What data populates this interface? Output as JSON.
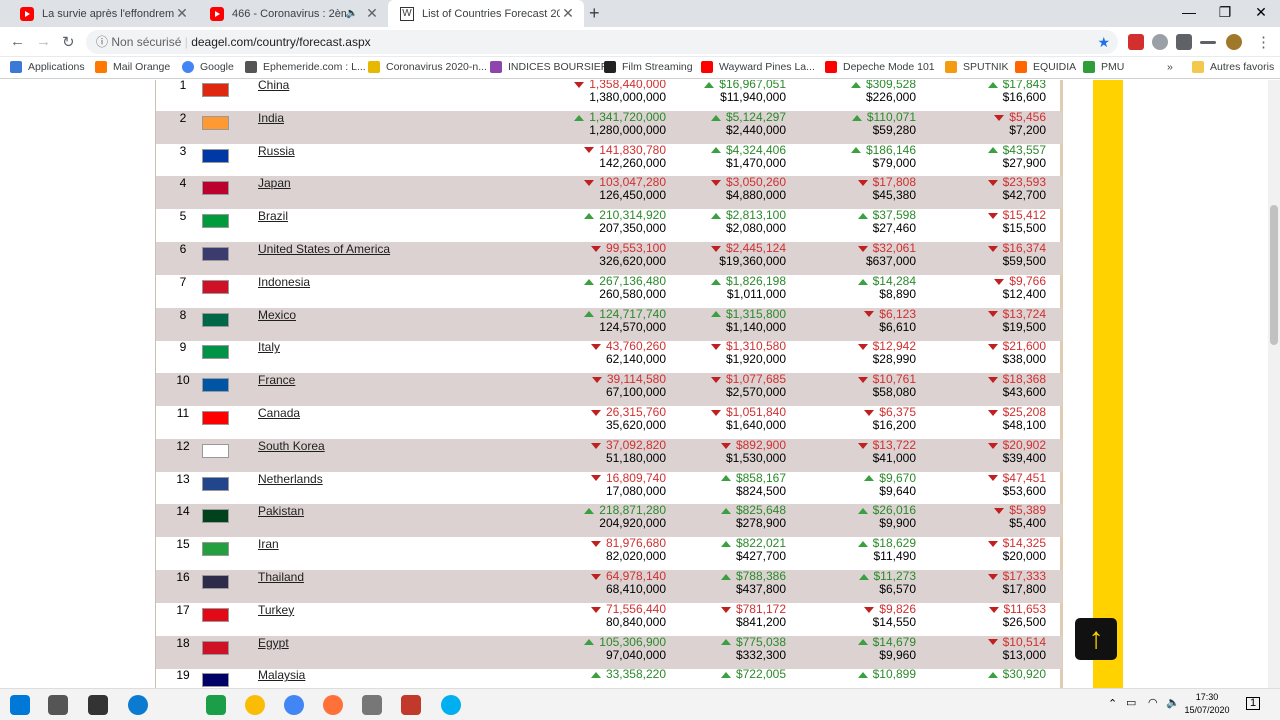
{
  "tabs": [
    {
      "title": "La survie après l'effondrement er",
      "icon": "youtube-icon"
    },
    {
      "title": "466 - Coronavirus : 2ème Sai",
      "icon": "youtube-icon"
    },
    {
      "title": "List of Countries Forecast 2025",
      "icon": "deagel-icon"
    }
  ],
  "address": {
    "security": "Non sécurisé",
    "url": "deagel.com/country/forecast.aspx"
  },
  "bookmarks": [
    {
      "label": "Applications",
      "color": "#3c78d8"
    },
    {
      "label": "Mail Orange",
      "color": "#ff7900"
    },
    {
      "label": "Google",
      "color": "#4285f4"
    },
    {
      "label": "Ephemeride.com : L...",
      "color": "#555"
    },
    {
      "label": "Coronavirus 2020-n...",
      "color": "#e6b800"
    },
    {
      "label": "INDICES BOURSIER",
      "color": "#8e44ad"
    },
    {
      "label": "Film Streaming",
      "color": "#222"
    },
    {
      "label": "Wayward Pines La...",
      "color": "#ff0000"
    },
    {
      "label": "Depeche Mode 101",
      "color": "#ff0000"
    },
    {
      "label": "SPUTNIK",
      "color": "#f39c12"
    },
    {
      "label": "EQUIDIA",
      "color": "#ff6600"
    },
    {
      "label": "PMU",
      "color": "#2e9e3a"
    },
    {
      "label": "Autres favoris",
      "color": "#f2c94c"
    }
  ],
  "more_bookmarks": "»",
  "countries": [
    {
      "rank": "1",
      "name": "China",
      "flag": "#de2910",
      "pop_f": "1,358,440,000",
      "pop_fd": "down",
      "pop_c": "1,380,000,000",
      "gdp_f": "$16,967,051",
      "gdp_fd": "up",
      "gdp_c": "$11,940,000",
      "ppp_f": "$309,528",
      "ppp_fd": "up",
      "ppp_c": "$226,000",
      "cap_f": "$17,843",
      "cap_fd": "up",
      "cap_c": "$16,600"
    },
    {
      "rank": "2",
      "name": "India",
      "flag": "#ff9933",
      "pop_f": "1,341,720,000",
      "pop_fd": "up",
      "pop_c": "1,280,000,000",
      "gdp_f": "$5,124,297",
      "gdp_fd": "up",
      "gdp_c": "$2,440,000",
      "ppp_f": "$110,071",
      "ppp_fd": "up",
      "ppp_c": "$59,280",
      "cap_f": "$5,456",
      "cap_fd": "down",
      "cap_c": "$7,200"
    },
    {
      "rank": "3",
      "name": "Russia",
      "flag": "#0039a6",
      "pop_f": "141,830,780",
      "pop_fd": "down",
      "pop_c": "142,260,000",
      "gdp_f": "$4,324,406",
      "gdp_fd": "up",
      "gdp_c": "$1,470,000",
      "ppp_f": "$186,146",
      "ppp_fd": "up",
      "ppp_c": "$79,000",
      "cap_f": "$43,557",
      "cap_fd": "up",
      "cap_c": "$27,900"
    },
    {
      "rank": "4",
      "name": "Japan",
      "flag": "#bc002d",
      "pop_f": "103,047,280",
      "pop_fd": "down",
      "pop_c": "126,450,000",
      "gdp_f": "$3,050,260",
      "gdp_fd": "down",
      "gdp_c": "$4,880,000",
      "ppp_f": "$17,808",
      "ppp_fd": "down",
      "ppp_c": "$45,380",
      "cap_f": "$23,593",
      "cap_fd": "down",
      "cap_c": "$42,700"
    },
    {
      "rank": "5",
      "name": "Brazil",
      "flag": "#009c3b",
      "pop_f": "210,314,920",
      "pop_fd": "up",
      "pop_c": "207,350,000",
      "gdp_f": "$2,813,100",
      "gdp_fd": "up",
      "gdp_c": "$2,080,000",
      "ppp_f": "$37,598",
      "ppp_fd": "up",
      "ppp_c": "$27,460",
      "cap_f": "$15,412",
      "cap_fd": "down",
      "cap_c": "$15,500"
    },
    {
      "rank": "6",
      "name": "United States of America",
      "flag": "#3c3b6e",
      "pop_f": "99,553,100",
      "pop_fd": "down",
      "pop_c": "326,620,000",
      "gdp_f": "$2,445,124",
      "gdp_fd": "down",
      "gdp_c": "$19,360,000",
      "ppp_f": "$32,061",
      "ppp_fd": "down",
      "ppp_c": "$637,000",
      "cap_f": "$16,374",
      "cap_fd": "down",
      "cap_c": "$59,500"
    },
    {
      "rank": "7",
      "name": "Indonesia",
      "flag": "#ce1126",
      "pop_f": "267,136,480",
      "pop_fd": "up",
      "pop_c": "260,580,000",
      "gdp_f": "$1,826,198",
      "gdp_fd": "up",
      "gdp_c": "$1,011,000",
      "ppp_f": "$14,284",
      "ppp_fd": "up",
      "ppp_c": "$8,890",
      "cap_f": "$9,766",
      "cap_fd": "down",
      "cap_c": "$12,400"
    },
    {
      "rank": "8",
      "name": "Mexico",
      "flag": "#006847",
      "pop_f": "124,717,740",
      "pop_fd": "up",
      "pop_c": "124,570,000",
      "gdp_f": "$1,315,800",
      "gdp_fd": "up",
      "gdp_c": "$1,140,000",
      "ppp_f": "$6,123",
      "ppp_fd": "down",
      "ppp_c": "$6,610",
      "cap_f": "$13,724",
      "cap_fd": "down",
      "cap_c": "$19,500"
    },
    {
      "rank": "9",
      "name": "Italy",
      "flag": "#009246",
      "pop_f": "43,760,260",
      "pop_fd": "down",
      "pop_c": "62,140,000",
      "gdp_f": "$1,310,580",
      "gdp_fd": "down",
      "gdp_c": "$1,920,000",
      "ppp_f": "$12,942",
      "ppp_fd": "down",
      "ppp_c": "$28,990",
      "cap_f": "$21,600",
      "cap_fd": "down",
      "cap_c": "$38,000"
    },
    {
      "rank": "10",
      "name": "France",
      "flag": "#0055a4",
      "pop_f": "39,114,580",
      "pop_fd": "down",
      "pop_c": "67,100,000",
      "gdp_f": "$1,077,685",
      "gdp_fd": "down",
      "gdp_c": "$2,570,000",
      "ppp_f": "$10,761",
      "ppp_fd": "down",
      "ppp_c": "$58,080",
      "cap_f": "$18,368",
      "cap_fd": "down",
      "cap_c": "$43,600"
    },
    {
      "rank": "11",
      "name": "Canada",
      "flag": "#ff0000",
      "pop_f": "26,315,760",
      "pop_fd": "down",
      "pop_c": "35,620,000",
      "gdp_f": "$1,051,840",
      "gdp_fd": "down",
      "gdp_c": "$1,640,000",
      "ppp_f": "$6,375",
      "ppp_fd": "down",
      "ppp_c": "$16,200",
      "cap_f": "$25,208",
      "cap_fd": "down",
      "cap_c": "$48,100"
    },
    {
      "rank": "12",
      "name": "South Korea",
      "flag": "#ffffff",
      "pop_f": "37,092,820",
      "pop_fd": "down",
      "pop_c": "51,180,000",
      "gdp_f": "$892,900",
      "gdp_fd": "down",
      "gdp_c": "$1,530,000",
      "ppp_f": "$13,722",
      "ppp_fd": "down",
      "ppp_c": "$41,000",
      "cap_f": "$20,902",
      "cap_fd": "down",
      "cap_c": "$39,400"
    },
    {
      "rank": "13",
      "name": "Netherlands",
      "flag": "#21468b",
      "pop_f": "16,809,740",
      "pop_fd": "down",
      "pop_c": "17,080,000",
      "gdp_f": "$858,167",
      "gdp_fd": "up",
      "gdp_c": "$824,500",
      "ppp_f": "$9,670",
      "ppp_fd": "up",
      "ppp_c": "$9,640",
      "cap_f": "$47,451",
      "cap_fd": "down",
      "cap_c": "$53,600"
    },
    {
      "rank": "14",
      "name": "Pakistan",
      "flag": "#01411c",
      "pop_f": "218,871,280",
      "pop_fd": "up",
      "pop_c": "204,920,000",
      "gdp_f": "$825,648",
      "gdp_fd": "up",
      "gdp_c": "$278,900",
      "ppp_f": "$26,016",
      "ppp_fd": "up",
      "ppp_c": "$9,900",
      "cap_f": "$5,389",
      "cap_fd": "down",
      "cap_c": "$5,400"
    },
    {
      "rank": "15",
      "name": "Iran",
      "flag": "#239f40",
      "pop_f": "81,976,680",
      "pop_fd": "down",
      "pop_c": "82,020,000",
      "gdp_f": "$822,021",
      "gdp_fd": "up",
      "gdp_c": "$427,700",
      "ppp_f": "$18,629",
      "ppp_fd": "up",
      "ppp_c": "$11,490",
      "cap_f": "$14,325",
      "cap_fd": "down",
      "cap_c": "$20,000"
    },
    {
      "rank": "16",
      "name": "Thailand",
      "flag": "#2d2a4a",
      "pop_f": "64,978,140",
      "pop_fd": "down",
      "pop_c": "68,410,000",
      "gdp_f": "$788,386",
      "gdp_fd": "up",
      "gdp_c": "$437,800",
      "ppp_f": "$11,273",
      "ppp_fd": "up",
      "ppp_c": "$6,570",
      "cap_f": "$17,333",
      "cap_fd": "down",
      "cap_c": "$17,800"
    },
    {
      "rank": "17",
      "name": "Turkey",
      "flag": "#e30a17",
      "pop_f": "71,556,440",
      "pop_fd": "down",
      "pop_c": "80,840,000",
      "gdp_f": "$781,172",
      "gdp_fd": "down",
      "gdp_c": "$841,200",
      "ppp_f": "$9,826",
      "ppp_fd": "down",
      "ppp_c": "$14,550",
      "cap_f": "$11,653",
      "cap_fd": "down",
      "cap_c": "$26,500"
    },
    {
      "rank": "18",
      "name": "Egypt",
      "flag": "#ce1126",
      "pop_f": "105,306,900",
      "pop_fd": "up",
      "pop_c": "97,040,000",
      "gdp_f": "$775,038",
      "gdp_fd": "up",
      "gdp_c": "$332,300",
      "ppp_f": "$14,679",
      "ppp_fd": "up",
      "ppp_c": "$9,960",
      "cap_f": "$10,514",
      "cap_fd": "down",
      "cap_c": "$13,000"
    },
    {
      "rank": "19",
      "name": "Malaysia",
      "flag": "#010066",
      "pop_f": "33,358,220",
      "pop_fd": "up",
      "pop_c": "",
      "gdp_f": "$722,005",
      "gdp_fd": "up",
      "gdp_c": "",
      "ppp_f": "$10,899",
      "ppp_fd": "up",
      "ppp_c": "",
      "cap_f": "$30,920",
      "cap_fd": "up",
      "cap_c": ""
    }
  ],
  "tray": {
    "time": "17:30",
    "date": "15/07/2020",
    "notif": "1"
  }
}
